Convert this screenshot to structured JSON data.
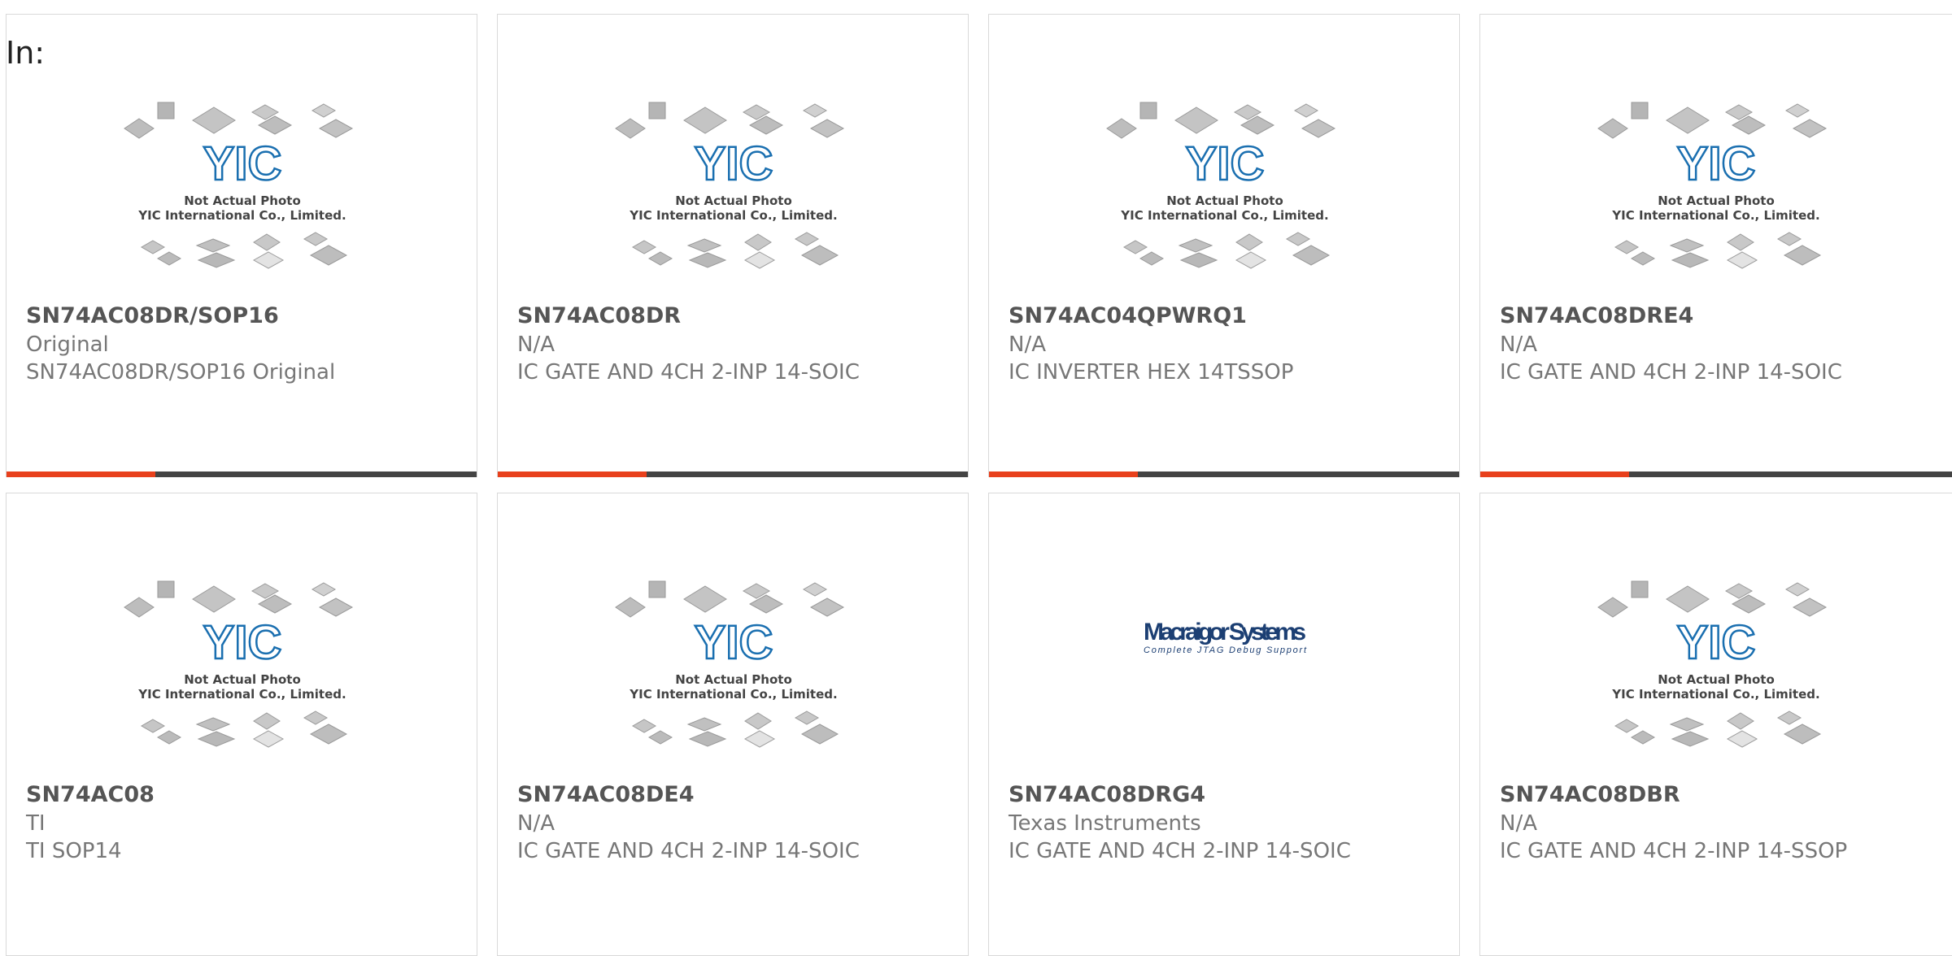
{
  "page": {
    "in_label": "In:"
  },
  "placeholder_text": {
    "line1": "Not Actual Photo",
    "line2": "YIC International Co., Limited.",
    "logo": "YIC"
  },
  "macraigor": {
    "name": "Macraigor Systems",
    "tag": "Complete JTAG Debug Support"
  },
  "colors": {
    "accent": "#e8401c",
    "bar": "#444444",
    "logo_blue": "#1a6fb0"
  },
  "products": [
    {
      "part": "SN74AC08DR/SOP16",
      "mfr": "Original",
      "desc": "SN74AC08DR/SOP16 Original",
      "image": "yic-placeholder"
    },
    {
      "part": "SN74AC08DR",
      "mfr": "N/A",
      "desc": "IC GATE AND 4CH 2-INP 14-SOIC",
      "image": "yic-placeholder"
    },
    {
      "part": "SN74AC04QPWRQ1",
      "mfr": "N/A",
      "desc": "IC INVERTER HEX 14TSSOP",
      "image": "yic-placeholder"
    },
    {
      "part": "SN74AC08DRE4",
      "mfr": "N/A",
      "desc": "IC GATE AND 4CH 2-INP 14-SOIC",
      "image": "yic-placeholder"
    },
    {
      "part": "SN74AC08",
      "mfr": "TI",
      "desc": "TI SOP14",
      "image": "yic-placeholder"
    },
    {
      "part": "SN74AC08DE4",
      "mfr": "N/A",
      "desc": "IC GATE AND 4CH 2-INP 14-SOIC",
      "image": "yic-placeholder"
    },
    {
      "part": "SN74AC08DRG4",
      "mfr": "Texas Instruments",
      "desc": "IC GATE AND 4CH 2-INP 14-SOIC",
      "image": "macraigor-logo"
    },
    {
      "part": "SN74AC08DBR",
      "mfr": "N/A",
      "desc": "IC GATE AND 4CH 2-INP 14-SSOP",
      "image": "yic-placeholder"
    }
  ]
}
